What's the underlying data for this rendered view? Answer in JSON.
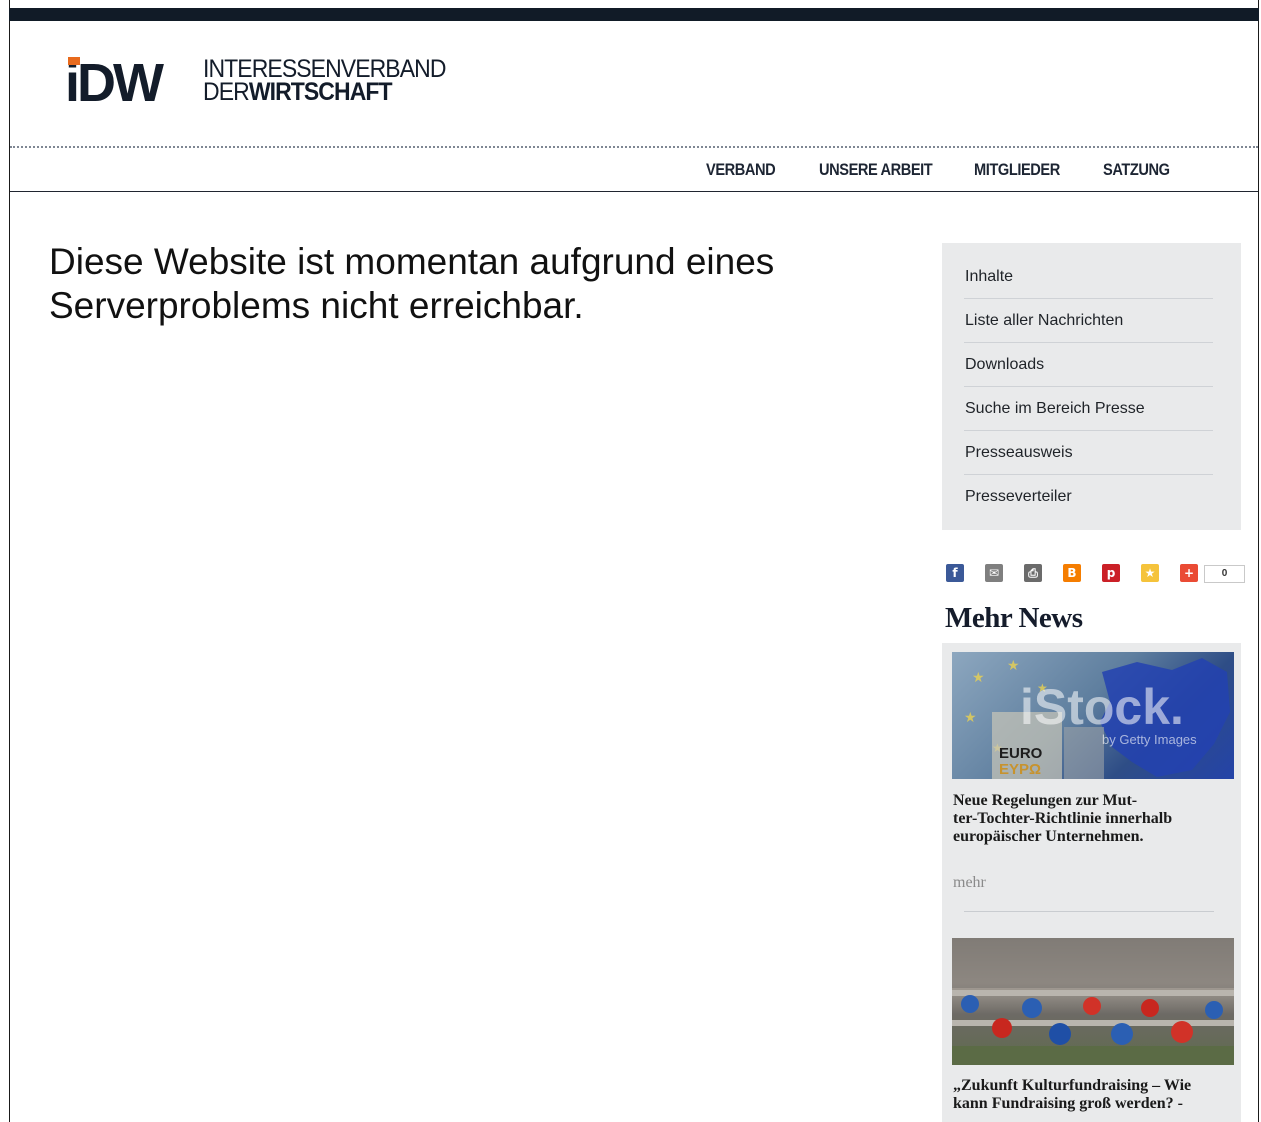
{
  "logo": {
    "mark": "iDW",
    "line1": "INTERESSENVERBAND",
    "line2_prefix": "DER",
    "line2_bold": "WIRTSCHAFT",
    "accent_color": "#e86a1c",
    "brand_color": "#131c2a"
  },
  "nav": {
    "items": [
      "VERBAND",
      "UNSERE ARBEIT",
      "MITGLIEDER",
      "SATZUNG"
    ]
  },
  "main": {
    "headline": "Diese Website ist momentan aufgrund eines Serverproblems nicht erreichbar."
  },
  "sidebar": {
    "menu": [
      "Inhalte",
      "Liste aller Nachrichten",
      "Downloads",
      "Suche im Bereich Presse",
      "Presseausweis",
      "Presseverteiler"
    ],
    "share": {
      "buttons": [
        {
          "name": "facebook-icon",
          "glyph": "f",
          "color": "#3b5998"
        },
        {
          "name": "email-icon",
          "glyph": "✉",
          "color": "#7f7f7f"
        },
        {
          "name": "print-icon",
          "glyph": "⎙",
          "color": "#6b6b6b"
        },
        {
          "name": "blogger-icon",
          "glyph": "B",
          "color": "#f57d00"
        },
        {
          "name": "pinterest-icon",
          "glyph": "p",
          "color": "#cb2027"
        },
        {
          "name": "favorite-icon",
          "glyph": "★",
          "color": "#f5c33b"
        },
        {
          "name": "more-share-icon",
          "glyph": "+",
          "color": "#ea4b34"
        }
      ],
      "count": "0"
    },
    "section_title": "Mehr News",
    "news": [
      {
        "image_watermark": "iStock",
        "image_subtext": "by Getty Images",
        "image_label": "EURO",
        "image_label2": "ΕΥΡΩ",
        "title": "Neue Regelungen zur Mut-ter-Tochter-Richtlinie innerhalb europäischer Unternehmen.",
        "title_lines": [
          "Neue Regelungen zur Mut-",
          "ter-Tochter-Richtlinie innerhalb",
          "europäischer Unternehmen."
        ],
        "more": "mehr"
      },
      {
        "title_lines": [
          "„Zukunft Kulturfundraising – Wie",
          "kann Fundraising groß werden? -"
        ]
      }
    ]
  }
}
